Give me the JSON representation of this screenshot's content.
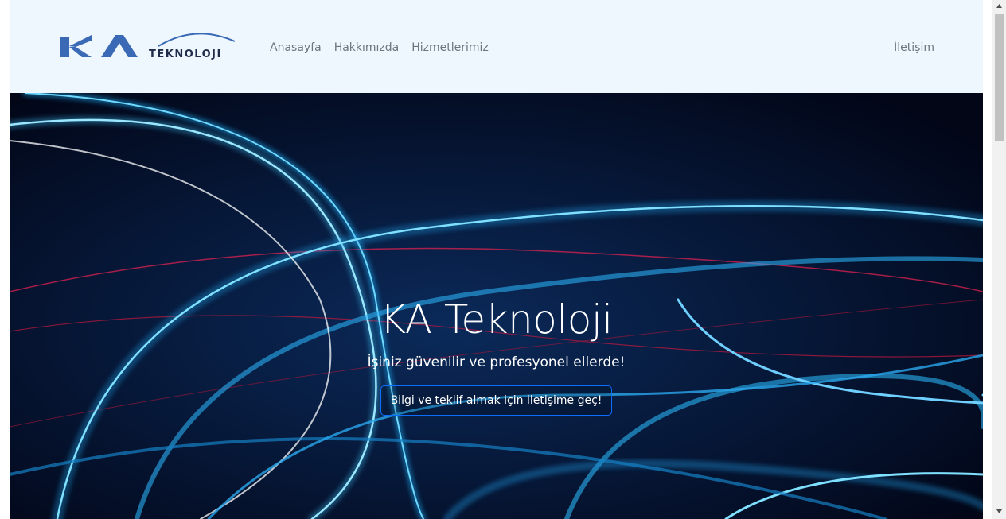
{
  "brand": {
    "logo_mark": "KA",
    "logo_word": "TEKNOLOJI",
    "colors": {
      "logo_blue": "#3a6ab5",
      "logo_dark": "#1f2d4a"
    }
  },
  "nav": {
    "items": [
      {
        "label": "Anasayfa"
      },
      {
        "label": "Hakkımızda"
      },
      {
        "label": "Hizmetlerimiz"
      }
    ],
    "right_item": {
      "label": "İletişim"
    }
  },
  "hero": {
    "title": "KA Teknoloji",
    "subtitle": "İşiniz güvenilir ve profesyonel ellerde!",
    "cta_label": "Bilgi ve teklif almak için iletişime geç!",
    "colors": {
      "background": "#020617",
      "cta_border": "#0d6efd"
    }
  },
  "scrollbar": {
    "up_icon": "chevron-up-icon",
    "down_icon": "chevron-down-icon"
  }
}
